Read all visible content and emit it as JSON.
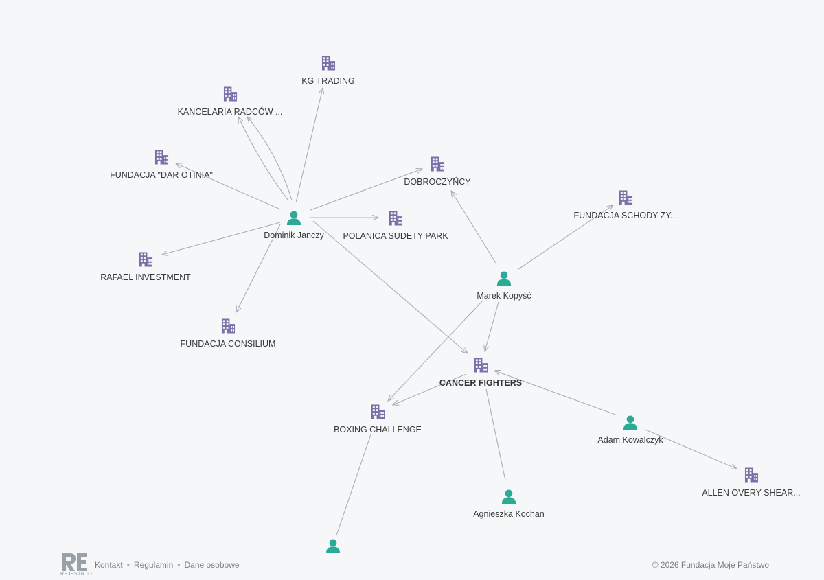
{
  "colors": {
    "person": "#2bab97",
    "company": "#7b6fa7",
    "edge": "#a9adb6",
    "background": "#f6f7f9"
  },
  "nodes": [
    {
      "id": "dominik",
      "type": "person",
      "label": "Dominik Janczy"
    },
    {
      "id": "kg",
      "type": "company",
      "label": "KG TRADING"
    },
    {
      "id": "kancelaria",
      "type": "company",
      "label": "KANCELARIA RADCÓW ..."
    },
    {
      "id": "dar",
      "type": "company",
      "label": "FUNDACJA \"DAR OTINIA\""
    },
    {
      "id": "rafael",
      "type": "company",
      "label": "RAFAEL INVESTMENT"
    },
    {
      "id": "consilium",
      "type": "company",
      "label": "FUNDACJA CONSILIUM"
    },
    {
      "id": "polanica",
      "type": "company",
      "label": "POLANICA SUDETY PARK"
    },
    {
      "id": "dobro",
      "type": "company",
      "label": "DOBROCZYŃCY"
    },
    {
      "id": "schody",
      "type": "company",
      "label": "FUNDACJA SCHODY ŻY..."
    },
    {
      "id": "marek",
      "type": "person",
      "label": "Marek Kopyść"
    },
    {
      "id": "cancer",
      "type": "company",
      "label": "CANCER FIGHTERS",
      "highlight": true
    },
    {
      "id": "boxing",
      "type": "company",
      "label": "BOXING CHALLENGE"
    },
    {
      "id": "adam",
      "type": "person",
      "label": "Adam Kowalczyk"
    },
    {
      "id": "allen",
      "type": "company",
      "label": "ALLEN OVERY SHEAR..."
    },
    {
      "id": "agnieszka",
      "type": "person",
      "label": "Agnieszka Kochan"
    },
    {
      "id": "partial",
      "type": "person",
      "label": ""
    }
  ],
  "edges": [
    {
      "from": "dominik",
      "to": "kg"
    },
    {
      "from": "dominik",
      "to": "kancelaria"
    },
    {
      "from": "dominik",
      "to": "kancelaria"
    },
    {
      "from": "dominik",
      "to": "dar"
    },
    {
      "from": "dominik",
      "to": "rafael"
    },
    {
      "from": "dominik",
      "to": "consilium"
    },
    {
      "from": "dominik",
      "to": "polanica"
    },
    {
      "from": "dominik",
      "to": "dobro"
    },
    {
      "from": "dominik",
      "to": "cancer"
    },
    {
      "from": "marek",
      "to": "dobro"
    },
    {
      "from": "marek",
      "to": "schody"
    },
    {
      "from": "marek",
      "to": "cancer"
    },
    {
      "from": "marek",
      "to": "boxing"
    },
    {
      "from": "cancer",
      "to": "boxing"
    },
    {
      "from": "adam",
      "to": "cancer"
    },
    {
      "from": "adam",
      "to": "allen"
    },
    {
      "from": "agnieszka",
      "to": "cancer"
    },
    {
      "from": "partial",
      "to": "boxing"
    }
  ],
  "footer": {
    "logo_text": "REJESTR.IO",
    "links": [
      "Kontakt",
      "Regulamin",
      "Dane osobowe"
    ],
    "copyright": "© 2026 Fundacja Moje Państwo"
  }
}
